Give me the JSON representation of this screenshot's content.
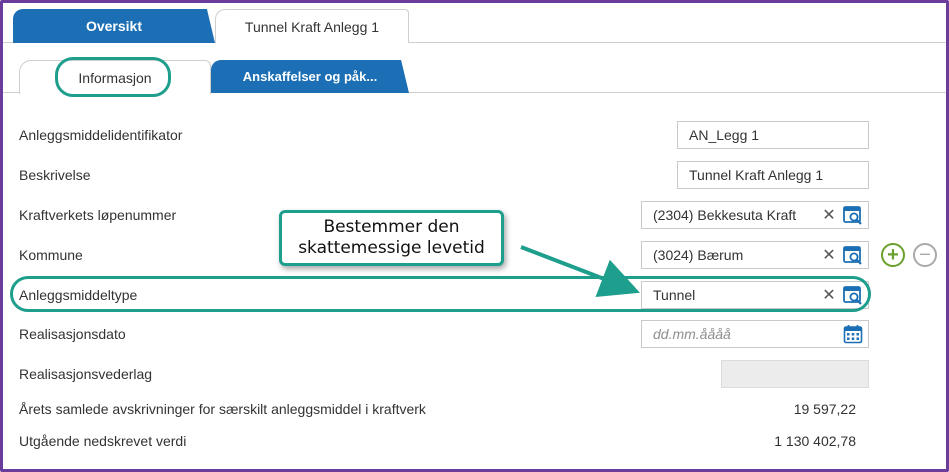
{
  "tabs_top": [
    {
      "label": "Oversikt",
      "active": true
    },
    {
      "label": "Tunnel Kraft Anlegg 1",
      "active": false
    }
  ],
  "tabs_sub": [
    {
      "label": "Informasjon",
      "selected": true
    },
    {
      "label": "Anskaffelser og påk...",
      "selected": false
    }
  ],
  "form": {
    "asset_id": {
      "label": "Anleggsmiddelidentifikator",
      "value": "AN_Legg 1"
    },
    "description": {
      "label": "Beskrivelse",
      "value": "Tunnel Kraft Anlegg 1"
    },
    "plant_number": {
      "label": "Kraftverkets løpenummer",
      "value": "(2304) Bekkesuta Kraft"
    },
    "municipality": {
      "label": "Kommune",
      "value": "(3024) Bærum"
    },
    "asset_type": {
      "label": "Anleggsmiddeltype",
      "value": "Tunnel"
    },
    "realization_date": {
      "label": "Realisasjonsdato",
      "placeholder": "dd.mm.åååå"
    },
    "realization_compensation": {
      "label": "Realisasjonsvederlag",
      "value": ""
    },
    "annual_depreciation": {
      "label": "Årets samlede avskrivninger for særskilt anleggsmiddel i kraftverk",
      "value": "19 597,22"
    },
    "written_down_value": {
      "label": "Utgående nedskrevet verdi",
      "value": "1 130 402,78"
    }
  },
  "callout": {
    "line1": "Bestemmer den",
    "line2": "skattemessige levetid"
  },
  "icons": {
    "clear": "close-icon",
    "lookup": "lookup-icon",
    "calendar": "calendar-icon",
    "add": "plus-circle-icon",
    "remove": "minus-circle-icon"
  },
  "colors": {
    "tab_blue": "#1c6fb5",
    "highlight": "#1e9e8c",
    "frame": "#6b3d9a",
    "add_green": "#6aa02c"
  }
}
